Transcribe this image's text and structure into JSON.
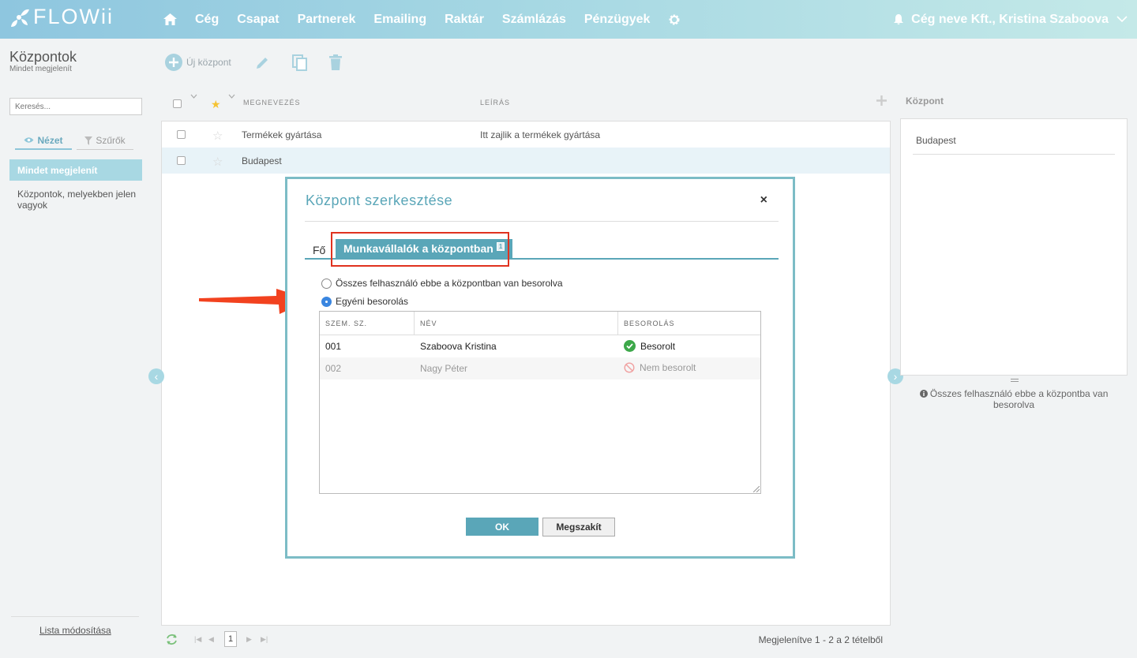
{
  "brand": {
    "name": "FLOWii"
  },
  "nav": {
    "items": [
      "Cég",
      "Csapat",
      "Partnerek",
      "Emailing",
      "Raktár",
      "Számlázás",
      "Pénzügyek"
    ],
    "company": "Cég neve Kft., Kristina Szaboova"
  },
  "page": {
    "title": "Központok",
    "subtitle": "Mindet megjelenít"
  },
  "toolbar": {
    "new_label": "Új központ"
  },
  "sidebar": {
    "search_placeholder": "Keresés...",
    "tab_view": "Nézet",
    "tab_filters": "Szűrők",
    "items": [
      "Mindet megjelenít",
      "Központok, melyekben jelen vagyok"
    ],
    "footer": "Lista módosítása"
  },
  "list": {
    "columns": {
      "name": "MEGNEVEZÉS",
      "description": "LEÍRÁS"
    },
    "rows": [
      {
        "name": "Termékek gyártása",
        "description": "Itt zajlik a termékek gyártása"
      },
      {
        "name": "Budapest",
        "description": ""
      }
    ],
    "pager": {
      "page": "1",
      "info": "Megjelenítve 1 - 2 a 2 tételből"
    }
  },
  "right_panel": {
    "title": "Központ",
    "item": "Budapest",
    "info": "Összes felhasználó ebbe a központba van besorolva"
  },
  "dialog": {
    "title": "Központ szerkesztése",
    "close": "×",
    "tab_main": "Fő",
    "tab_employees": "Munkavállalók a központban",
    "tab_badge": "1",
    "radio_all": "Összes felhasználó ebbe a központban van besorolva",
    "radio_individual": "Egyéni besorolás",
    "table": {
      "headers": [
        "SZEM. SZ.",
        "NÉV",
        "BESOROLÁS"
      ],
      "rows": [
        {
          "id": "001",
          "name": "Szaboova Kristina",
          "status": "Besorolt"
        },
        {
          "id": "002",
          "name": "Nagy Péter",
          "status": "Nem besorolt"
        }
      ]
    },
    "ok": "OK",
    "cancel": "Megszakít"
  },
  "colors": {
    "accent": "#5aa6b8",
    "highlight": "#e0321f",
    "status_ok": "#3da84a"
  }
}
